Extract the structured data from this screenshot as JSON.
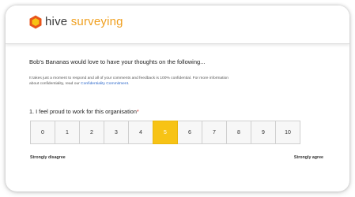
{
  "brand": {
    "word1": "hive",
    "word2": "surveying",
    "accent_color": "#f0a020",
    "hex_colors": [
      "#f7c315",
      "#e8561b"
    ]
  },
  "survey": {
    "intro": "Bob's Bananas would love to have your thoughts on the following...",
    "note_text": "It takes just a moment to respond and all of your comments and feedback is 100% confidential. For more information about confidentiality, read our ",
    "note_link": "Confidentiality Commitment",
    "note_end": "."
  },
  "question": {
    "number_text": "1. I feel proud to work for this organisation",
    "required_mark": "*",
    "options": [
      "0",
      "1",
      "2",
      "3",
      "4",
      "5",
      "6",
      "7",
      "8",
      "9",
      "10"
    ],
    "selected_value": "5",
    "selected_color": "#f7c315",
    "low_anchor": "Strongly disagree",
    "high_anchor": "Strongly agree"
  }
}
